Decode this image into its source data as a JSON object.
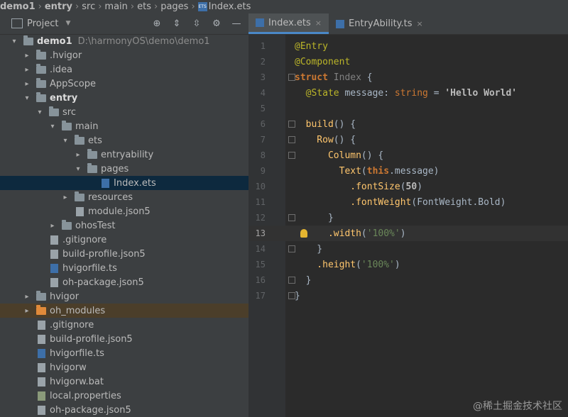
{
  "breadcrumb": [
    "demo1",
    "entry",
    "src",
    "main",
    "ets",
    "pages",
    "Index.ets"
  ],
  "project_panel": {
    "title": "Project",
    "rows": [
      {
        "label": "demo1",
        "path": "D:\\harmonyOS\\demo\\demo1",
        "level": 0,
        "arrow": "▾",
        "icon": "folder",
        "bold": true
      },
      {
        "label": ".hvigor",
        "level": 1,
        "arrow": "▸",
        "icon": "folder"
      },
      {
        "label": ".idea",
        "level": 1,
        "arrow": "▸",
        "icon": "folder"
      },
      {
        "label": "AppScope",
        "level": 1,
        "arrow": "▸",
        "icon": "folder"
      },
      {
        "label": "entry",
        "level": 1,
        "arrow": "▾",
        "icon": "folder",
        "bold": true
      },
      {
        "label": "src",
        "level": 2,
        "arrow": "▾",
        "icon": "folder"
      },
      {
        "label": "main",
        "level": 3,
        "arrow": "▾",
        "icon": "folder"
      },
      {
        "label": "ets",
        "level": 4,
        "arrow": "▾",
        "icon": "folder"
      },
      {
        "label": "entryability",
        "level": 5,
        "arrow": "▸",
        "icon": "folder"
      },
      {
        "label": "pages",
        "level": 5,
        "arrow": "▾",
        "icon": "folder"
      },
      {
        "label": "Index.ets",
        "level": 6,
        "arrow": "",
        "icon": "ets",
        "selected": true
      },
      {
        "label": "resources",
        "level": 4,
        "arrow": "▸",
        "icon": "folder"
      },
      {
        "label": "module.json5",
        "level": 4,
        "arrow": "",
        "icon": "file"
      },
      {
        "label": "ohosTest",
        "level": 3,
        "arrow": "▸",
        "icon": "folder"
      },
      {
        "label": ".gitignore",
        "level": 2,
        "arrow": "",
        "icon": "file"
      },
      {
        "label": "build-profile.json5",
        "level": 2,
        "arrow": "",
        "icon": "file"
      },
      {
        "label": "hvigorfile.ts",
        "level": 2,
        "arrow": "",
        "icon": "ts"
      },
      {
        "label": "oh-package.json5",
        "level": 2,
        "arrow": "",
        "icon": "file"
      },
      {
        "label": "hvigor",
        "level": 1,
        "arrow": "▸",
        "icon": "folder"
      },
      {
        "label": "oh_modules",
        "level": 1,
        "arrow": "▸",
        "icon": "folder-orange",
        "excluded": true
      },
      {
        "label": ".gitignore",
        "level": 1,
        "arrow": "",
        "icon": "file"
      },
      {
        "label": "build-profile.json5",
        "level": 1,
        "arrow": "",
        "icon": "file"
      },
      {
        "label": "hvigorfile.ts",
        "level": 1,
        "arrow": "",
        "icon": "ts"
      },
      {
        "label": "hvigorw",
        "level": 1,
        "arrow": "",
        "icon": "file"
      },
      {
        "label": "hvigorw.bat",
        "level": 1,
        "arrow": "",
        "icon": "file"
      },
      {
        "label": "local.properties",
        "level": 1,
        "arrow": "",
        "icon": "props"
      },
      {
        "label": "oh-package.json5",
        "level": 1,
        "arrow": "",
        "icon": "file"
      }
    ]
  },
  "tabs": [
    {
      "label": "Index.ets",
      "active": true
    },
    {
      "label": "EntryAbility.ts",
      "active": false
    }
  ],
  "code_lines": [
    {
      "n": "1",
      "tokens": [
        [
          "@Entry",
          "#bbb529"
        ]
      ]
    },
    {
      "n": "2",
      "tokens": [
        [
          "@Component",
          "#bbb529"
        ]
      ]
    },
    {
      "n": "3",
      "tokens": [
        [
          "struct ",
          "#cc7832b"
        ],
        [
          "Index",
          "#808080"
        ],
        [
          " {",
          "#a9b7c6"
        ]
      ]
    },
    {
      "n": "4",
      "tokens": [
        [
          "  @State",
          "#bbb529"
        ],
        [
          " message: ",
          "#a9b7c6"
        ],
        [
          "string",
          "#cc7832"
        ],
        [
          " = ",
          "#a9b7c6"
        ],
        [
          "'Hello World'",
          "#c77dbb"
        ]
      ]
    },
    {
      "n": "5",
      "tokens": []
    },
    {
      "n": "6",
      "tokens": [
        [
          "  build",
          "#ffc66d"
        ],
        [
          "() {",
          "#a9b7c6"
        ]
      ]
    },
    {
      "n": "7",
      "tokens": [
        [
          "    Row",
          "#ffc66d"
        ],
        [
          "() {",
          "#a9b7c6"
        ]
      ]
    },
    {
      "n": "8",
      "tokens": [
        [
          "      Column",
          "#ffc66d"
        ],
        [
          "() {",
          "#a9b7c6"
        ]
      ]
    },
    {
      "n": "9",
      "tokens": [
        [
          "        Text",
          "#ffc66d"
        ],
        [
          "(",
          "#a9b7c6"
        ],
        [
          "this",
          "#cc7832b"
        ],
        [
          ".message)",
          "#a9b7c6"
        ]
      ]
    },
    {
      "n": "10",
      "tokens": [
        [
          "          .fontSize",
          "#ffc66d"
        ],
        [
          "(",
          "#a9b7c6"
        ],
        [
          "50",
          "#6897bb"
        ],
        [
          ")",
          "#a9b7c6"
        ]
      ]
    },
    {
      "n": "11",
      "tokens": [
        [
          "          .fontWeight",
          "#ffc66d"
        ],
        [
          "(FontWeight.Bold)",
          "#a9b7c6"
        ]
      ]
    },
    {
      "n": "12",
      "tokens": [
        [
          "      }",
          "#a9b7c6"
        ]
      ]
    },
    {
      "n": "13",
      "tokens": [
        [
          "      .width",
          "#ffc66d"
        ],
        [
          "(",
          "#a9b7c6"
        ],
        [
          "'100%'",
          "#6a8759"
        ],
        [
          ")",
          "#a9b7c6"
        ]
      ],
      "current": true
    },
    {
      "n": "14",
      "tokens": [
        [
          "    }",
          "#a9b7c6"
        ]
      ]
    },
    {
      "n": "15",
      "tokens": [
        [
          "    .height",
          "#ffc66d"
        ],
        [
          "(",
          "#a9b7c6"
        ],
        [
          "'100%'",
          "#6a8759"
        ],
        [
          ")",
          "#a9b7c6"
        ]
      ]
    },
    {
      "n": "16",
      "tokens": [
        [
          "  }",
          "#a9b7c6"
        ]
      ]
    },
    {
      "n": "17",
      "tokens": [
        [
          "}",
          "#a9b7c6"
        ]
      ]
    }
  ],
  "watermark": "@稀土掘金技术社区"
}
